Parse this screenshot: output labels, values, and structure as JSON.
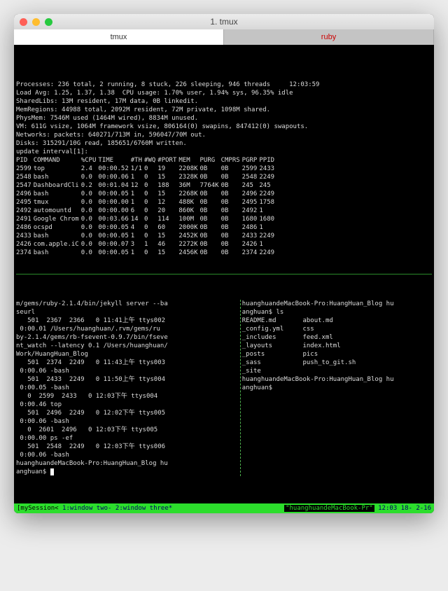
{
  "window": {
    "title": "1. tmux",
    "tabs": [
      {
        "label": "tmux",
        "active": true
      },
      {
        "label": "ruby",
        "active": false
      }
    ]
  },
  "top_header": {
    "l1": "Processes: 236 total, 2 running, 8 stuck, 226 sleeping, 946 threads     12:03:59",
    "l2": "Load Avg: 1.25, 1.37, 1.38  CPU usage: 1.70% user, 1.94% sys, 96.35% idle",
    "l3": "SharedLibs: 13M resident, 17M data, 0B linkedit.",
    "l4": "MemRegions: 44988 total, 2092M resident, 72M private, 1098M shared.",
    "l5": "PhysMem: 7546M used (1464M wired), 8834M unused.",
    "l6": "VM: 611G vsize, 1064M framework vsize, 806164(0) swapins, 847412(0) swapouts.",
    "l7": "Networks: packets: 640271/713M in, 596047/70M out.",
    "l8": "Disks: 315291/10G read, 185651/6760M written.",
    "l9": "update interval[1]:"
  },
  "top_cols": [
    "PID",
    "COMMAND",
    "%CPU",
    "TIME",
    "#TH",
    "#WQ",
    "#PORT",
    "MEM",
    "PURG",
    "CMPRS",
    "PGRP",
    "PPID"
  ],
  "top_rows": [
    [
      "2599",
      "top",
      "2.4",
      "00:00.52",
      "1/1",
      "0",
      "19",
      "2208K",
      "0B",
      "0B",
      "2599",
      "2433"
    ],
    [
      "2548",
      "bash",
      "0.0",
      "00:00.06",
      "1",
      "0",
      "15",
      "2328K",
      "0B",
      "0B",
      "2548",
      "2249"
    ],
    [
      "2547",
      "DashboardCli",
      "0.2",
      "00:01.04",
      "12",
      "0",
      "188",
      "36M",
      "7764K",
      "0B",
      "245",
      "245"
    ],
    [
      "2496",
      "bash",
      "0.0",
      "00:00.05",
      "1",
      "0",
      "15",
      "2268K",
      "0B",
      "0B",
      "2496",
      "2249"
    ],
    [
      "2495",
      "tmux",
      "0.0",
      "00:00.00",
      "1",
      "0",
      "12",
      "488K",
      "0B",
      "0B",
      "2495",
      "1758"
    ],
    [
      "2492",
      "automountd",
      "0.0",
      "00:00.00",
      "6",
      "0",
      "20",
      "860K",
      "0B",
      "0B",
      "2492",
      "1"
    ],
    [
      "2491",
      "Google Chrom",
      "0.0",
      "00:03.66",
      "14",
      "0",
      "114",
      "100M",
      "0B",
      "0B",
      "1680",
      "1680"
    ],
    [
      "2486",
      "ocspd",
      "0.0",
      "00:00.05",
      "4",
      "0",
      "60",
      "2000K",
      "0B",
      "0B",
      "2486",
      "1"
    ],
    [
      "2433",
      "bash",
      "0.0",
      "00:00.05",
      "1",
      "0",
      "15",
      "2452K",
      "0B",
      "0B",
      "2433",
      "2249"
    ],
    [
      "2426",
      "com.apple.iC",
      "0.0",
      "00:00.07",
      "3",
      "1",
      "46",
      "2272K",
      "0B",
      "0B",
      "2426",
      "1"
    ],
    [
      "2374",
      "bash",
      "0.0",
      "00:00.05",
      "1",
      "0",
      "15",
      "2456K",
      "0B",
      "0B",
      "2374",
      "2249"
    ]
  ],
  "pane_left": {
    "lines": [
      "m/gems/ruby-2.1.4/bin/jekyll server --ba",
      "seurl",
      "   501  2367  2366   0 11:41上午 ttys002",
      " 0:00.01 /Users/huanghuan/.rvm/gems/ru",
      "by-2.1.4/gems/rb-fsevent-0.9.7/bin/fseve",
      "nt_watch --latency 0.1 /Users/huanghuan/",
      "Work/HuangHuan_Blog",
      "   501  2374  2249   0 11:43上午 ttys003",
      " 0:00.06 -bash",
      "   501  2433  2249   0 11:50上午 ttys004",
      " 0:00.05 -bash",
      "   0  2599  2433   0 12:03下午 ttys004",
      " 0:00.46 top",
      "   501  2496  2249   0 12:02下午 ttys005",
      " 0:00.06 -bash",
      "   0  2601  2496   0 12:03下午 ttys005",
      " 0:00.00 ps -ef",
      "   501  2548  2249   0 12:03下午 ttys006",
      " 0:00.06 -bash",
      "huanghuandeMacBook-Pro:HuangHuan_Blog hu",
      "anghuan$ "
    ]
  },
  "pane_right": {
    "prompt1": "huanghuandeMacBook-Pro:HuangHuan_Blog hu",
    "prompt2": "anghuan$ ls",
    "files": [
      [
        "README.md",
        "about.md"
      ],
      [
        "_config.yml",
        "css"
      ],
      [
        "_includes",
        "feed.xml"
      ],
      [
        "_layouts",
        "index.html"
      ],
      [
        "_posts",
        "pics"
      ],
      [
        "_sass",
        "push_to_git.sh"
      ],
      [
        "_site",
        ""
      ]
    ],
    "prompt3": "huanghuandeMacBook-Pro:HuangHuan_Blog hu",
    "prompt4": "anghuan$"
  },
  "statusbar": {
    "session": "[mySession< ",
    "win1": "1:window two-",
    "win2": "2:window three*",
    "host": "\"huanghuandeMacBook-Pr\"",
    "time": "12:03 18- 2-16"
  }
}
